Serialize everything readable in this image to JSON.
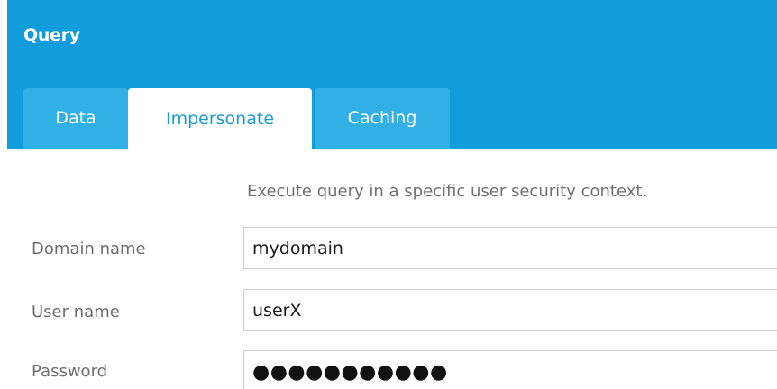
{
  "header": {
    "title": "Query"
  },
  "tabs": [
    {
      "label": "Data",
      "active": false
    },
    {
      "label": "Impersonate",
      "active": true
    },
    {
      "label": "Caching",
      "active": false
    }
  ],
  "impersonate": {
    "description": "Execute query in a specific user security context.",
    "domain": {
      "label": "Domain name",
      "value": "mydomain"
    },
    "user": {
      "label": "User name",
      "value": "userX"
    },
    "password": {
      "label": "Password",
      "masked_value": "●●●●●●●●●●●"
    }
  },
  "colors": {
    "header_bg": "#119ddb",
    "tab_inactive_bg": "#31b0e6",
    "tab_active_text": "#1a9bd7",
    "label_text": "#6d6d6d"
  }
}
